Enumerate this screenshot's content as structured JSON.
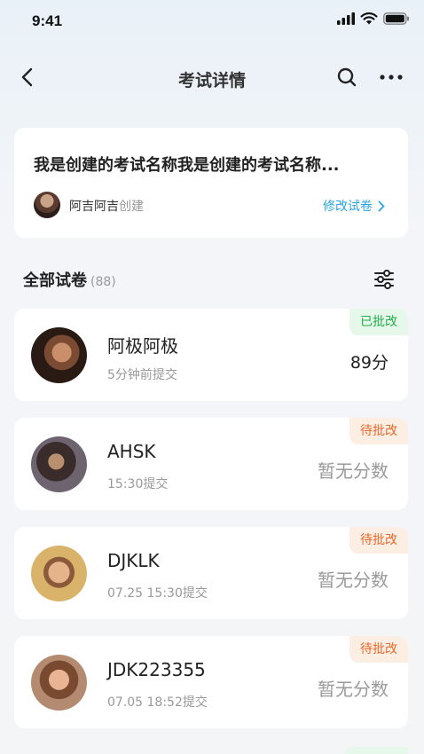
{
  "status_bar": {
    "time": "9:41"
  },
  "nav": {
    "title": "考试详情"
  },
  "exam": {
    "name": "我是创建的考试名称我是创建的考试名称...",
    "creator_name": "阿吉阿吉",
    "creator_suffix": "创建",
    "edit_label": "修改试卷"
  },
  "section": {
    "title": "全部试卷",
    "count": "(88)"
  },
  "papers": [
    {
      "name": "阿极阿极",
      "time": "5分钟前提交",
      "badge": "已批改",
      "score": "89分"
    },
    {
      "name": "AHSK",
      "time": "15:30提交",
      "badge": "待批改",
      "score": "暂无分数"
    },
    {
      "name": "DJKLK",
      "time": "07.25 15:30提交",
      "badge": "待批改",
      "score": "暂无分数"
    },
    {
      "name": "JDK223355",
      "time": "07.05 18:52提交",
      "badge": "待批改",
      "score": "暂无分数"
    }
  ],
  "colors": {
    "graded": "#21b04b",
    "pending": "#e8692a",
    "link": "#2aa4e6"
  }
}
